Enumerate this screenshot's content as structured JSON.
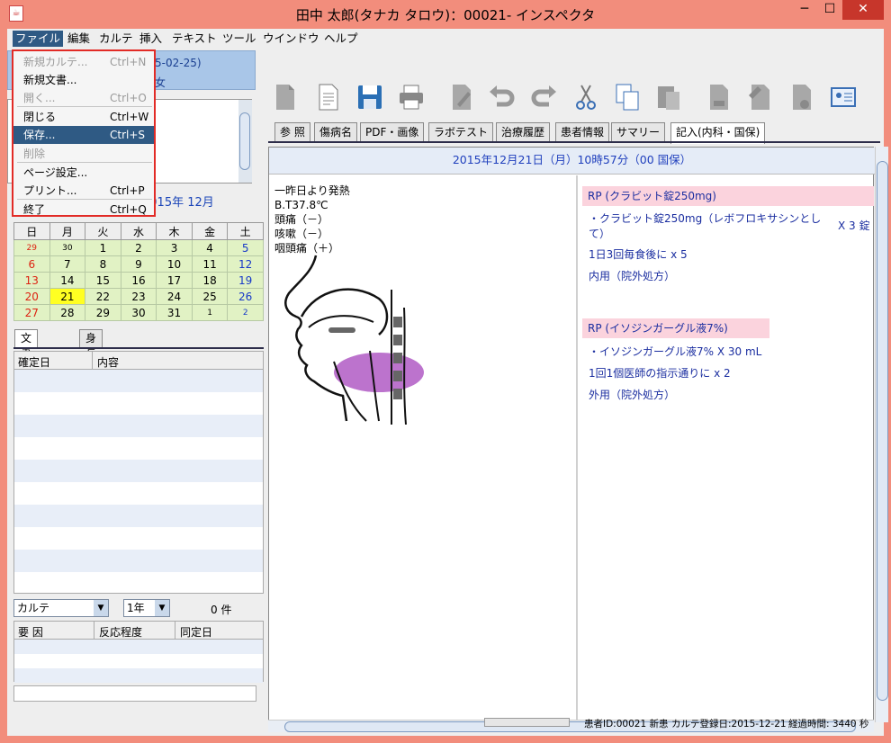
{
  "window": {
    "title": "田中 太郎(タナカ タロウ)：00021- インスペクタ",
    "minimize": "─",
    "maximize": "☐",
    "close": "✕"
  },
  "menubar": {
    "file": "ファイル",
    "edit": "編集",
    "karte": "カルテ",
    "insert": "挿入",
    "text": "テキスト",
    "tool": "ツール",
    "window": "ウインドウ",
    "help": "ヘルプ"
  },
  "file_menu": [
    {
      "label": "新規カルテ...",
      "shortcut": "Ctrl+N",
      "enabled": false
    },
    {
      "label": "新規文書...",
      "shortcut": "",
      "enabled": true
    },
    {
      "label": "開く...",
      "shortcut": "Ctrl+O",
      "enabled": false
    },
    {
      "label": "閉じる",
      "shortcut": "Ctrl+W",
      "enabled": true
    },
    {
      "label": "保存...",
      "shortcut": "Ctrl+S",
      "enabled": true,
      "selected": true
    },
    {
      "label": "削除",
      "shortcut": "",
      "enabled": false
    },
    {
      "label": "ページ設定...",
      "shortcut": "",
      "enabled": true
    },
    {
      "label": "プリント...",
      "shortcut": "Ctrl+P",
      "enabled": true
    },
    {
      "label": "終了",
      "shortcut": "Ctrl+Q",
      "enabled": true
    }
  ],
  "patient": {
    "line1": "5-02-25)",
    "line2": "女"
  },
  "calendar": {
    "header": "2015年 12月",
    "weekdays": [
      "日",
      "月",
      "火",
      "水",
      "木",
      "金",
      "土"
    ],
    "weeks": [
      [
        "29",
        "30",
        "1",
        "2",
        "3",
        "4",
        "5"
      ],
      [
        "6",
        "7",
        "8",
        "9",
        "10",
        "11",
        "12"
      ],
      [
        "13",
        "14",
        "15",
        "16",
        "17",
        "18",
        "19"
      ],
      [
        "20",
        "21",
        "22",
        "23",
        "24",
        "25",
        "26"
      ],
      [
        "27",
        "28",
        "29",
        "30",
        "31",
        "1",
        "2"
      ]
    ],
    "today": "21"
  },
  "left_tabs": {
    "doc_history": "文書履歴",
    "height_weight": "身長体重"
  },
  "doc_list": {
    "col_date": "確定日",
    "col_content": "内容"
  },
  "filters": {
    "type": "カルテ",
    "period": "1年",
    "count": "0 件"
  },
  "allergy": {
    "col_factor": "要 因",
    "col_reaction": "反応程度",
    "col_date": "同定日"
  },
  "tabs": [
    "参 照",
    "傷病名",
    "PDF・画像",
    "ラボテスト",
    "治療履歴",
    "患者情報",
    "サマリー",
    "記入(内科・国保)"
  ],
  "karte": {
    "date": "2015年12月21日（月）10時57分（00 国保）",
    "soa": [
      "一昨日より発熱",
      "B.T37.8℃",
      "頭痛（－）",
      "咳嗽（－）",
      "咽頭痛（＋）"
    ],
    "rp1": {
      "title": "RP (クラビット錠250mg)",
      "drug": "・クラビット錠250mg（レボフロキサシンとして）",
      "qty": "X 3  錠",
      "usage": "1日3回毎食後に x 5",
      "route": "内用（院外処方）"
    },
    "rp2": {
      "title": "RP (イソジンガーグル液7%)",
      "drug": "・イソジンガーグル液7%  X 30  mL",
      "usage": "1回1個医師の指示通りに x 2",
      "route": "外用（院外処方）"
    }
  },
  "status": {
    "patient_id": "患者ID:00021 新患",
    "karte_date": "カルテ登録日:2015-12-21",
    "elapsed": "経過時間: 3440 秒"
  },
  "icons": [
    "new-karte-icon",
    "new-doc-icon",
    "save-icon",
    "print-icon",
    "edit-icon",
    "undo-icon",
    "redo-icon",
    "cut-icon",
    "copy-icon",
    "paste-icon",
    "stamp-icon",
    "image-icon",
    "pencil-doc-icon",
    "id-card-icon"
  ]
}
